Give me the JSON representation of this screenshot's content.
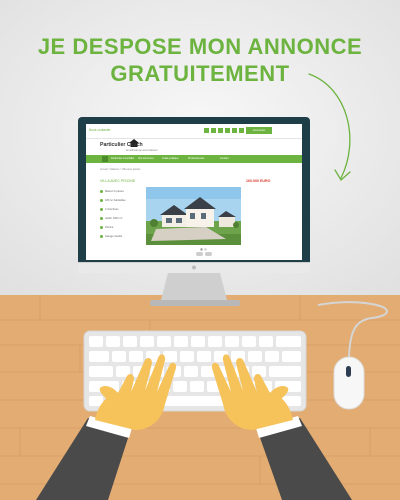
{
  "headline": {
    "line1": "JE DESPOSE MON ANNONCE",
    "line2": "GRATUITEMENT"
  },
  "colors": {
    "brand_green": "#6db33f",
    "price_red": "#d63a2a",
    "wall": "#ebebeb",
    "desk": "#e3ac72",
    "sleeve": "#4a4a4a",
    "skin": "#f6c25a"
  },
  "website": {
    "top_left": "Nous contacter",
    "login_button": "Connexion",
    "logo_name": "Particulier Coach",
    "logo_tagline": "la méthode qui vend vraiment",
    "nav": [
      "Particulier immobilier",
      "Vos annonces",
      "Guide pratique",
      "Professionnels",
      "Contact"
    ],
    "breadcrumb": "Accueil > Maisons > Villa avec piscine",
    "listing_title": "VILLA AVEC PISCINE",
    "listing_price": "160.000 EURO",
    "specs": [
      "Maison 6 pièces",
      "180 m² habitables",
      "4 chambres",
      "Jardin 1000 m²",
      "Piscine",
      "Garage double"
    ]
  },
  "icons": [
    "curved-arrow-icon",
    "home-icon",
    "mouse-icon"
  ]
}
